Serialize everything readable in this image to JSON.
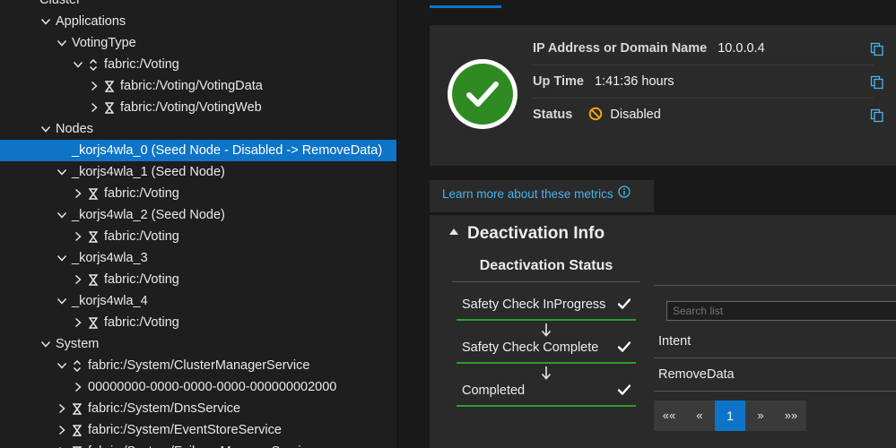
{
  "tree": {
    "rows": [
      {
        "label": "Cluster",
        "indent": 0,
        "chevron": "none"
      },
      {
        "label": "Applications",
        "indent": 1,
        "chevron": "down"
      },
      {
        "label": "VotingType",
        "indent": 2,
        "chevron": "down"
      },
      {
        "label": "fabric:/Voting",
        "indent": 3,
        "chevron": "down",
        "status": "upgrading"
      },
      {
        "label": "fabric:/Voting/VotingData",
        "indent": 4,
        "chevron": "right",
        "status": "hourglass"
      },
      {
        "label": "fabric:/Voting/VotingWeb",
        "indent": 4,
        "chevron": "right",
        "status": "hourglass"
      },
      {
        "label": "Nodes",
        "indent": 1,
        "chevron": "down"
      },
      {
        "label": "_korjs4wla_0 (Seed Node - Disabled -> RemoveData)",
        "indent": 2,
        "chevron": "none",
        "selected": true
      },
      {
        "label": "_korjs4wla_1 (Seed Node)",
        "indent": 2,
        "chevron": "down"
      },
      {
        "label": "fabric:/Voting",
        "indent": 3,
        "chevron": "right",
        "status": "hourglass"
      },
      {
        "label": "_korjs4wla_2 (Seed Node)",
        "indent": 2,
        "chevron": "down"
      },
      {
        "label": "fabric:/Voting",
        "indent": 3,
        "chevron": "right",
        "status": "hourglass"
      },
      {
        "label": "_korjs4wla_3",
        "indent": 2,
        "chevron": "down"
      },
      {
        "label": "fabric:/Voting",
        "indent": 3,
        "chevron": "right",
        "status": "hourglass"
      },
      {
        "label": "_korjs4wla_4",
        "indent": 2,
        "chevron": "down"
      },
      {
        "label": "fabric:/Voting",
        "indent": 3,
        "chevron": "right",
        "status": "hourglass"
      },
      {
        "label": "System",
        "indent": 1,
        "chevron": "down"
      },
      {
        "label": "fabric:/System/ClusterManagerService",
        "indent": 2,
        "chevron": "down",
        "status": "upgrading"
      },
      {
        "label": "00000000-0000-0000-0000-000000002000",
        "indent": 3,
        "chevron": "right"
      },
      {
        "label": "fabric:/System/DnsService",
        "indent": 2,
        "chevron": "right",
        "status": "hourglass"
      },
      {
        "label": "fabric:/System/EventStoreService",
        "indent": 2,
        "chevron": "right",
        "status": "hourglass"
      },
      {
        "label": "fabric:/System/FailoverManagerService",
        "indent": 2,
        "chevron": "right",
        "status": "hourglass"
      }
    ]
  },
  "essentials": {
    "ip_label": "IP Address or Domain Name",
    "ip_value": "10.0.0.4",
    "uptime_label": "Up Time",
    "uptime_value": "1:41:36 hours",
    "status_label": "Status",
    "status_value": "Disabled"
  },
  "learn_more": "Learn more about these metrics",
  "deactivation": {
    "title": "Deactivation Info",
    "status_header": "Deactivation Status",
    "steps": [
      "Safety Check InProgress",
      "Safety Check Complete",
      "Completed"
    ],
    "search_placeholder": "Search list",
    "list_items": [
      "Intent",
      "RemoveData"
    ],
    "pager": [
      "««",
      "«",
      "1",
      "»",
      "»»"
    ]
  },
  "colors": {
    "accent": "#0e74c8",
    "healthy": "#2e8b22",
    "step_ok": "#2e9e2e",
    "link": "#49b3ee",
    "warning": "#f0a30a"
  }
}
